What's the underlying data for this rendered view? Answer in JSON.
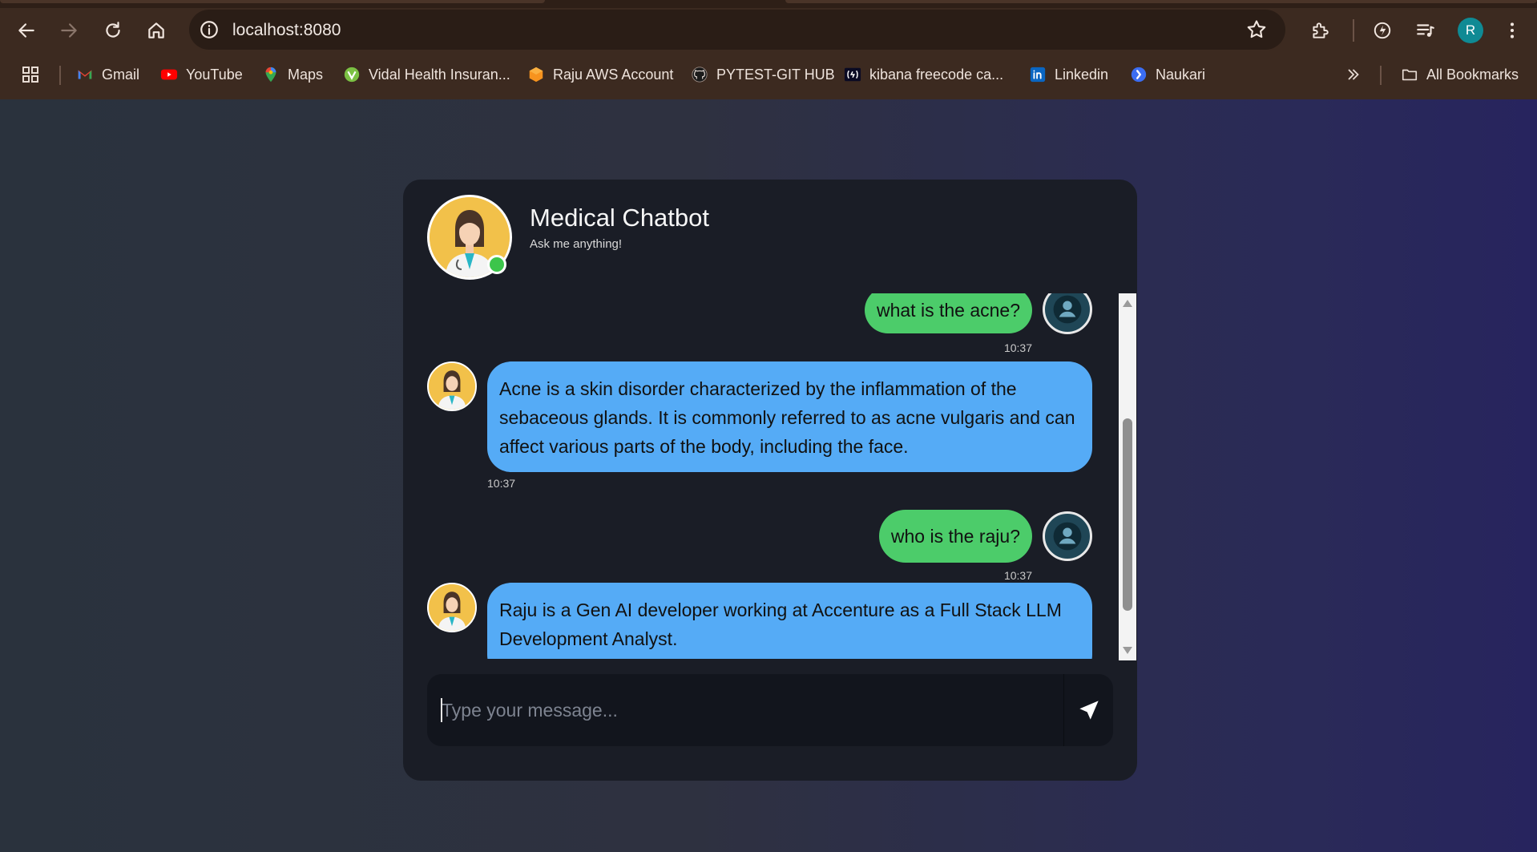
{
  "browser": {
    "url": "localhost:8080",
    "profile_initial": "R",
    "icons": [
      "back-icon",
      "forward-icon",
      "reload-icon",
      "home-icon",
      "site-info-icon",
      "bookmark-star-icon",
      "extensions-icon",
      "performance-icon",
      "media-control-icon",
      "menu-icon"
    ],
    "bookmarks": [
      {
        "label": "Gmail",
        "icon": "gmail-icon"
      },
      {
        "label": "YouTube",
        "icon": "youtube-icon"
      },
      {
        "label": "Maps",
        "icon": "maps-icon"
      },
      {
        "label": "Vidal Health Insuran...",
        "icon": "vidal-icon"
      },
      {
        "label": "Raju AWS Account",
        "icon": "aws-icon"
      },
      {
        "label": "PYTEST-GIT HUB",
        "icon": "github-icon"
      },
      {
        "label": "kibana freecode ca...",
        "icon": "freecodecamp-icon"
      },
      {
        "label": "Linkedin",
        "icon": "linkedin-icon"
      },
      {
        "label": "Naukari",
        "icon": "naukri-icon"
      }
    ],
    "all_bookmarks_label": "All Bookmarks"
  },
  "chat": {
    "title": "Medical Chatbot",
    "subtitle": "Ask me anything!",
    "messages": [
      {
        "sender": "user",
        "text": "what is the acne?",
        "time": "10:37"
      },
      {
        "sender": "bot",
        "text": "Acne is a skin disorder characterized by the inflammation of the sebaceous glands. It is commonly referred to as acne vulgaris and can affect various parts of the body, including the face.",
        "time": "10:37"
      },
      {
        "sender": "user",
        "text": "who is the raju?",
        "time": "10:37"
      },
      {
        "sender": "bot",
        "text": "Raju is a Gen AI developer working at Accenture as a Full Stack LLM Development Analyst.",
        "time": ""
      }
    ],
    "input_placeholder": "Type your message..."
  },
  "colors": {
    "user_bubble": "#4ccc6a",
    "bot_bubble": "#55abf6",
    "card_bg": "#1a1d26",
    "online": "#3cc54b"
  }
}
